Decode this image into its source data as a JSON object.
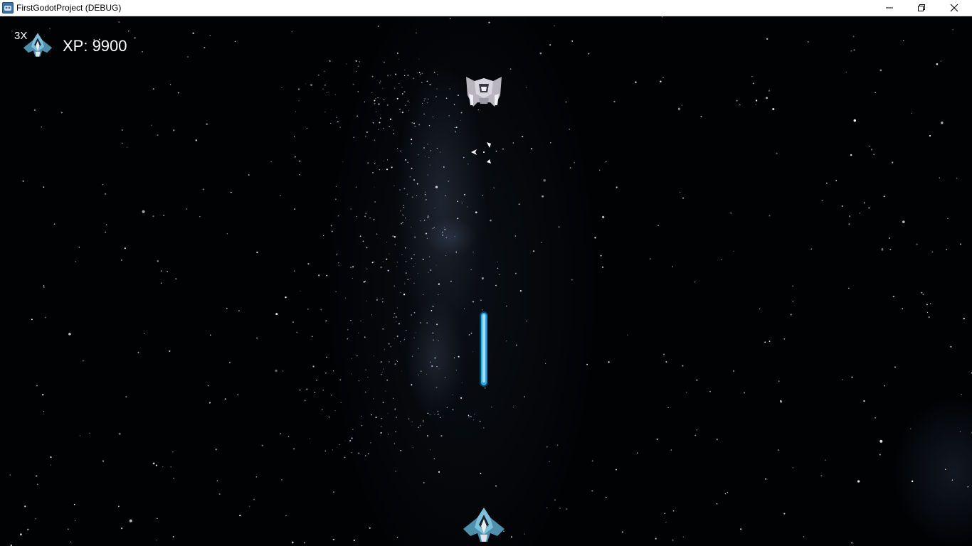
{
  "window": {
    "title": "FirstGodotProject (DEBUG)",
    "icon": "godot-app-icon",
    "controls": [
      "minimize",
      "restore",
      "close"
    ]
  },
  "hud": {
    "lives_label": "3X",
    "lives_icon": "player-ship-icon",
    "xp_label": "XP: 9900"
  },
  "scene": {
    "background": "starfield",
    "sprites": [
      "enemy-ship",
      "target-reticle",
      "laser-bolt",
      "player-ship"
    ]
  },
  "colors": {
    "titlebar": "#ffffff",
    "space": "#010204",
    "laser": "#4fc3f7",
    "player_hull": "#5aa9c9",
    "enemy_hull": "#c9c7cf",
    "hud_text": "#ffffff"
  }
}
